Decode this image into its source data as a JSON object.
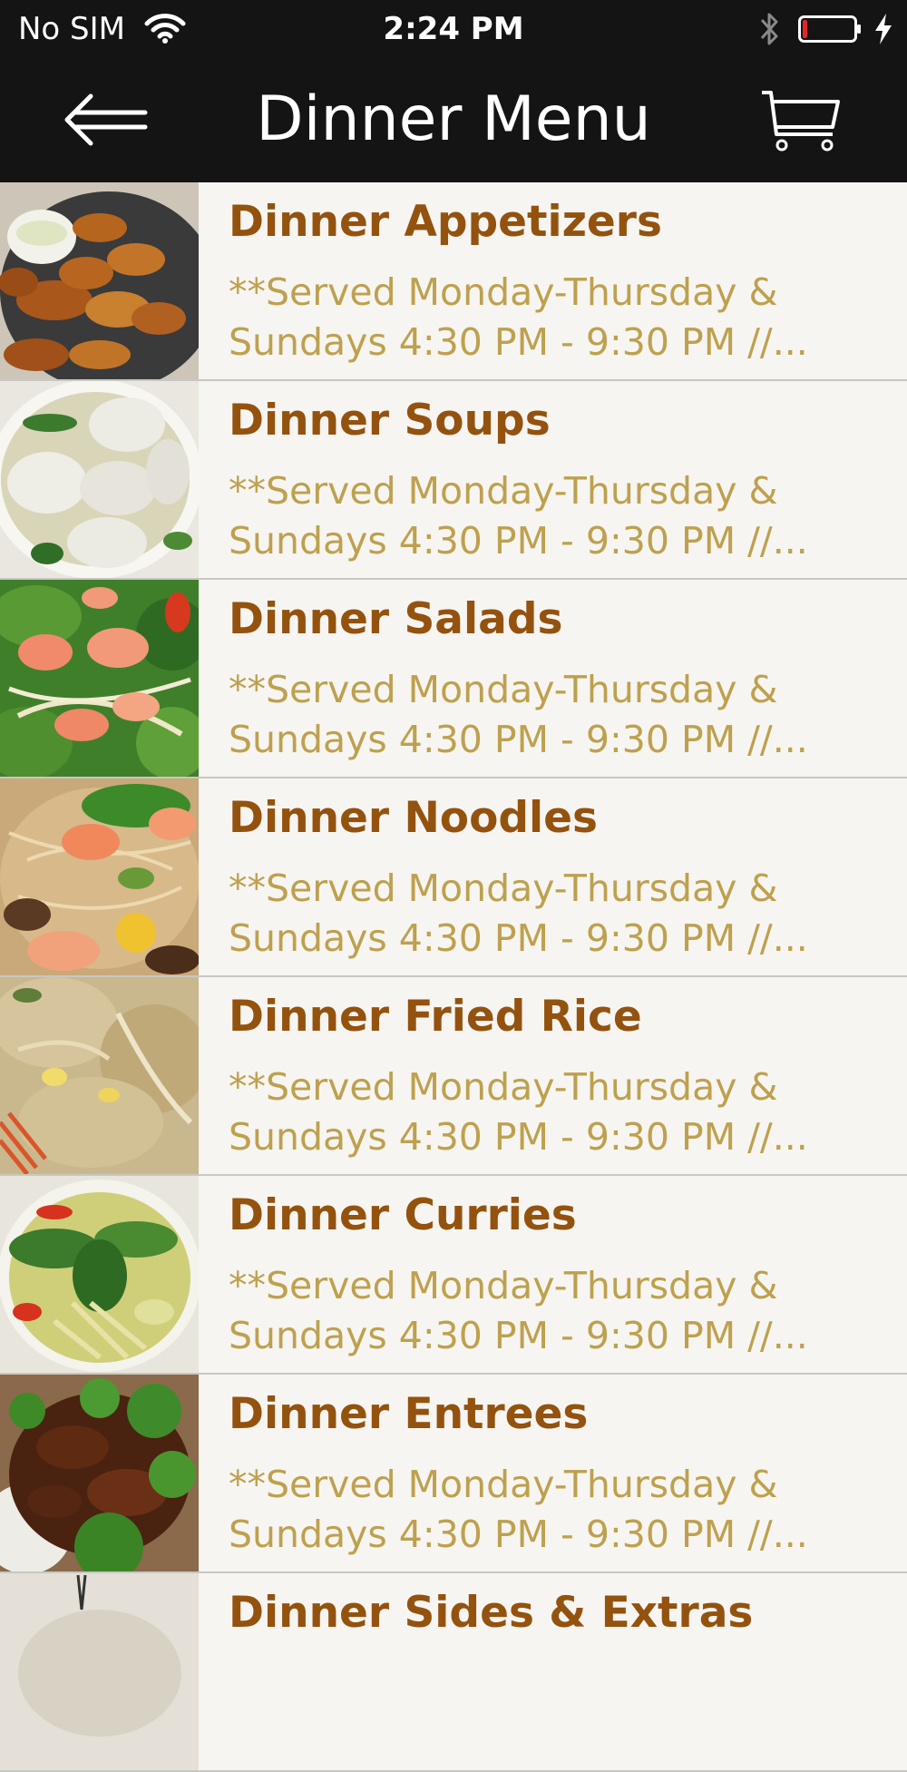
{
  "status_bar": {
    "carrier": "No SIM",
    "time": "2:24 PM",
    "icons": [
      "wifi-icon",
      "bluetooth-icon",
      "battery-icon",
      "charging-bolt-icon"
    ]
  },
  "nav": {
    "title": "Dinner Menu",
    "back_icon": "back-arrow-icon",
    "cart_icon": "cart-icon"
  },
  "colors": {
    "bar_background": "#141414",
    "list_background": "#f6f5f1",
    "title_text": "#94520f",
    "description_text": "#bea04e",
    "battery_low": "#e0262a"
  },
  "menu": [
    {
      "title": "Dinner Appetizers",
      "description": "**Served Monday-Thursday &\nSundays 4:30 PM - 9:30 PM //...",
      "image": "fried-chicken-wings-photo"
    },
    {
      "title": "Dinner Soups",
      "description": "**Served Monday-Thursday &\nSundays 4:30 PM - 9:30 PM //...",
      "image": "wonton-soup-photo"
    },
    {
      "title": "Dinner Salads",
      "description": "**Served Monday-Thursday &\nSundays 4:30 PM - 9:30 PM //...",
      "image": "shrimp-salad-photo"
    },
    {
      "title": "Dinner Noodles",
      "description": "**Served Monday-Thursday &\nSundays 4:30 PM - 9:30 PM //...",
      "image": "shrimp-noodles-photo"
    },
    {
      "title": "Dinner Fried Rice",
      "description": "**Served Monday-Thursday &\nSundays 4:30 PM - 9:30 PM //...",
      "image": "fried-rice-photo"
    },
    {
      "title": "Dinner Curries",
      "description": "**Served Monday-Thursday &\nSundays 4:30 PM - 9:30 PM //...",
      "image": "green-curry-photo"
    },
    {
      "title": "Dinner Entrees",
      "description": "**Served Monday-Thursday &\nSundays 4:30 PM - 9:30 PM //...",
      "image": "beef-broccoli-photo"
    },
    {
      "title": "Dinner Sides & Extras",
      "description": "",
      "image": "sides-photo"
    }
  ]
}
